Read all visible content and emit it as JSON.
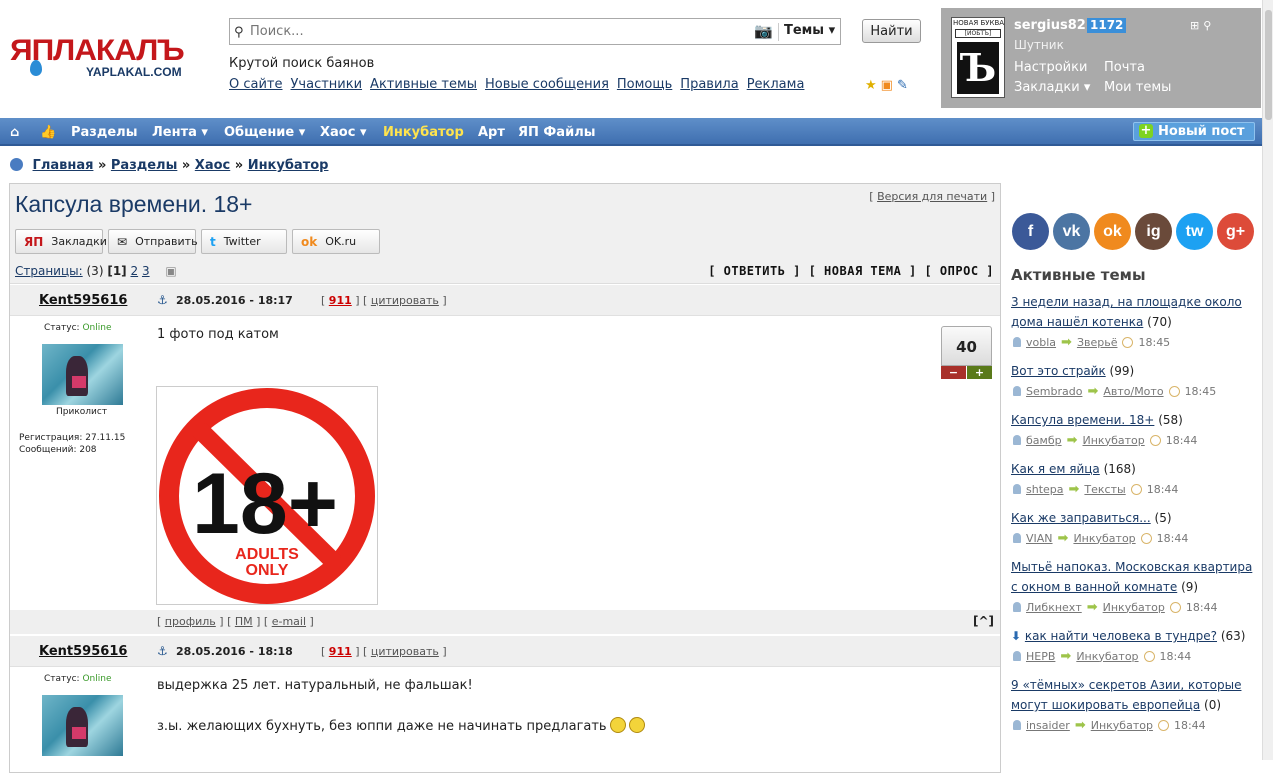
{
  "logo": {
    "ru": "ЯПЛАКАЛЪ",
    "en": "YAPLAKAL.COM"
  },
  "search": {
    "placeholder": "Поиск...",
    "scope": "Темы",
    "button": "Найти"
  },
  "tagline": "Крутой поиск баянов",
  "topnav": [
    "О сайте",
    "Участники",
    "Активные темы",
    "Новые сообщения",
    "Помощь",
    "Правила",
    "Реклама"
  ],
  "user": {
    "avatar_top": "НОВАЯ БУКВА",
    "avatar_box": "[ЙОБТЪ]",
    "avatar_letter": "Ъ",
    "name": "sergius82",
    "rep": "1172",
    "title": "Шутник",
    "links": [
      "Настройки",
      "Почта",
      "Закладки ▾",
      "Мои темы"
    ]
  },
  "navbar": {
    "items": [
      "Разделы",
      "Лента ▾",
      "Общение ▾",
      "Хаос ▾",
      "Инкубатор",
      "Арт",
      "ЯП Файлы"
    ],
    "new_post": "Новый пост"
  },
  "breadcrumb": [
    "Главная",
    "Разделы",
    "Хаос",
    "Инкубатор"
  ],
  "topic": {
    "title": "Капсула времени. 18+",
    "print": "Версия для печати",
    "share": [
      "Закладки",
      "Отправить",
      "Twitter",
      "OK.ru"
    ],
    "pages_label": "Страницы:",
    "pages_count": "(3)",
    "pages_current": "[1]",
    "pages_other": [
      "2",
      "3"
    ],
    "actions": "[ ОТВЕТИТЬ ] [ НОВАЯ ТЕМА ] [ ОПРОС ]"
  },
  "posts": [
    {
      "author": "Kent595616",
      "date": "28.05.2016 - 18:17",
      "num": "911",
      "quote": "цитировать",
      "status_label": "Статус:",
      "status": "Online",
      "rank": "Приколист",
      "reg": "Регистрация: 27.11.15",
      "msgs": "Сообщений: 208",
      "text": "1 фото под катом",
      "rating": "40",
      "image_text": {
        "big": "18+",
        "line1": "ADULTS",
        "line2": "ONLY"
      },
      "footer_links": [
        "профиль",
        "ПМ",
        "e-mail"
      ],
      "up": "[^]"
    },
    {
      "author": "Kent595616",
      "date": "28.05.2016 - 18:18",
      "num": "911",
      "quote": "цитировать",
      "status_label": "Статус:",
      "status": "Online",
      "text1": "выдержка 25 лет. натуральный, не фальшак!",
      "text2": "з.ы. желающих бухнуть, без юппи даже не начинать предлагать"
    }
  ],
  "social": [
    "f",
    "vk",
    "ok",
    "ig",
    "tw",
    "g+"
  ],
  "active": {
    "title": "Активные темы",
    "items": [
      {
        "t": "3 недели назад, на площадке около дома нашёл котенка",
        "c": "(70)",
        "u": "vobla",
        "s": "Зверьё",
        "time": "18:45"
      },
      {
        "t": "Вот это страйк",
        "c": "(99)",
        "u": "Sembrado",
        "s": "Авто/Мото",
        "time": "18:45"
      },
      {
        "t": "Капсула времени. 18+",
        "c": "(58)",
        "u": "бамбр",
        "s": "Инкубатор",
        "time": "18:44"
      },
      {
        "t": "Как я ем яйца",
        "c": "(168)",
        "u": "shtepa",
        "s": "Тексты",
        "time": "18:44"
      },
      {
        "t": "Как же заправиться...",
        "c": "(5)",
        "u": "VIAN",
        "s": "Инкубатор",
        "time": "18:44"
      },
      {
        "t": "Мытьё напоказ. Московская квартира с окном в ванной комнате",
        "c": "(9)",
        "u": "Либкнехт",
        "s": "Инкубатор",
        "time": "18:44"
      },
      {
        "t": "как найти человека в тундре?",
        "c": "(63)",
        "u": "НЕРВ",
        "s": "Инкубатор",
        "time": "18:44"
      },
      {
        "t": "9 «тёмных» секретов Азии, которые могут шокировать европейца",
        "c": "(0)",
        "u": "insaider",
        "s": "Инкубатор",
        "time": "18:44"
      }
    ]
  }
}
